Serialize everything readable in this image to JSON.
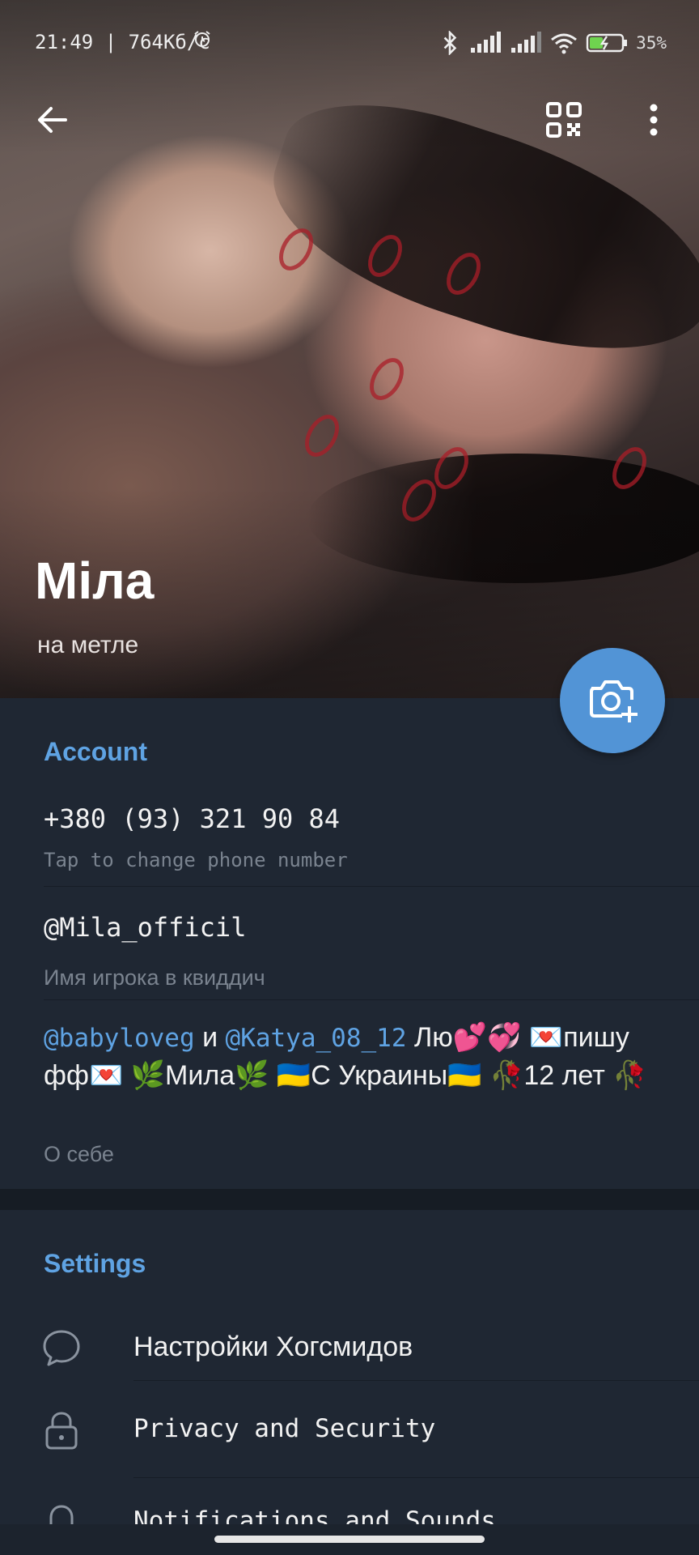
{
  "status_bar": {
    "time_speed": "21:49 | 764Кб/с",
    "battery_percent": "35%",
    "icons": [
      "alarm-icon",
      "bluetooth-icon",
      "signal-icon",
      "signal-icon",
      "wifi-icon",
      "battery-charging-icon"
    ]
  },
  "header": {
    "back_icon": "arrow-left-icon",
    "qr_icon": "qr-code-icon",
    "more_icon": "more-vertical-icon",
    "name": "Міла",
    "status": "на метле"
  },
  "camera_button": {
    "icon": "add-photo-icon"
  },
  "account": {
    "title": "Account",
    "phone": "+380 (93) 321 90 84",
    "phone_hint": "Tap to change phone number",
    "username": "@Mila_officil",
    "username_hint": "Имя игрока в квиддич",
    "bio": {
      "mention1": "@babyloveg",
      "and": " и ",
      "mention2": "@Katya_08_12",
      "rest": " Лю💕💞 💌пишу фф💌 🌿Мила🌿 🇺🇦С Украины🇺🇦 🥀12 лет 🥀"
    },
    "bio_hint": "О себе"
  },
  "settings": {
    "title": "Settings",
    "items": [
      {
        "label": "Настройки Хогсмидов",
        "icon": "chat-bubble-icon"
      },
      {
        "label": "Privacy and Security",
        "icon": "lock-icon"
      },
      {
        "label": "Notifications and Sounds",
        "icon": "bell-icon"
      }
    ]
  },
  "colors": {
    "background": "#1f2733",
    "accent": "#5fa3e3",
    "fab": "#5294d6",
    "text_primary": "#f2f2f2",
    "text_secondary": "#7a838f"
  }
}
